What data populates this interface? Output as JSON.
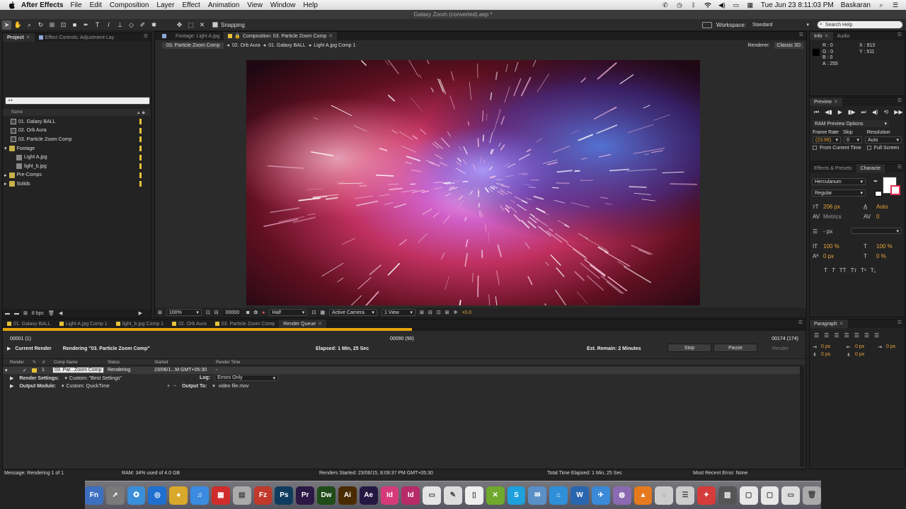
{
  "menubar": {
    "app_name": "After Effects",
    "items": [
      "File",
      "Edit",
      "Composition",
      "Layer",
      "Effect",
      "Animation",
      "View",
      "Window",
      "Help"
    ],
    "clock": "Tue Jun 23  8:11:03 PM",
    "user": "Baskaran"
  },
  "window_title": "Galaxy Zoom (converted).aep *",
  "toolbar": {
    "snapping_label": "Snapping",
    "workspace_label": "Workspace:",
    "workspace_value": "Standard",
    "search_placeholder": "Search Help"
  },
  "project_panel": {
    "tabs": [
      "Project",
      "Effect Controls: Adjustment Lay"
    ],
    "search_value": "",
    "column_name": "Name",
    "items": [
      {
        "name": "01. Galaxy BALL",
        "type": "comp",
        "indent": 0
      },
      {
        "name": "02. Orb Aura",
        "type": "comp",
        "indent": 0
      },
      {
        "name": "03. Particle Zoom Comp",
        "type": "comp",
        "indent": 0
      },
      {
        "name": "Footage",
        "type": "folder",
        "indent": 0
      },
      {
        "name": "Light A.jpg",
        "type": "img",
        "indent": 1
      },
      {
        "name": "light_b.jpg",
        "type": "img",
        "indent": 1
      },
      {
        "name": "Pre-Comps",
        "type": "folder",
        "indent": 0
      },
      {
        "name": "Solids",
        "type": "folder",
        "indent": 0
      }
    ],
    "bpc": "8 bpc"
  },
  "comp_panel": {
    "tabs": [
      "Footage: Light A.jpg",
      "Composition: 03. Particle Zoom Comp"
    ],
    "breadcrumbs": [
      "03. Particle Zoom Comp",
      "02. Orb Aura",
      "01. Galaxy BALL",
      "Light A.jpg Comp 1"
    ],
    "renderer_label": "Renderer:",
    "renderer_value": "Classic 3D",
    "zoom": "100%",
    "timecode": "00000",
    "resolution": "Half",
    "camera": "Active Camera",
    "views": "1 View",
    "exposure": "+0.0"
  },
  "info_panel": {
    "tabs": [
      "Info",
      "Audio"
    ],
    "r": "R : 0",
    "g": "G : 0",
    "b": "B : 0",
    "a": "A : 255",
    "x": "X : 913",
    "y": "Y : 511"
  },
  "preview_panel": {
    "tab": "Preview",
    "ram_options": "RAM Preview Options",
    "frame_rate_label": "Frame Rate",
    "skip_label": "Skip",
    "resolution_label": "Resolution",
    "frame_rate_value": "(23.98)",
    "skip_value": "0",
    "resolution_value": "Auto",
    "from_current": "From Current Time",
    "full_screen": "Full Screen"
  },
  "character_panel": {
    "tabs": [
      "Effects & Presets",
      "Characte"
    ],
    "font": "Herculanum",
    "style": "Regular",
    "size": "206 px",
    "leading": "Auto",
    "kerning": "Metrics",
    "tracking": "0",
    "stroke": "- px",
    "v_scale": "100 %",
    "h_scale": "100 %",
    "baseline": "0 px",
    "tsume": "0 %"
  },
  "paragraph_panel": {
    "tab": "Paragraph",
    "v1": "0 px",
    "v2": "0 px",
    "v3": "0 px",
    "v4": "0 px",
    "v5": "0 px"
  },
  "timeline_tabs": [
    "01. Galaxy BALL",
    "Light A.jpg Comp 1",
    "light_b.jpg Comp 1",
    "02. Orb Aura",
    "03. Particle Zoom Comp",
    "Render Queue"
  ],
  "render_queue": {
    "start_frame": "00001 (1)",
    "mid_frame": "00090 (90)",
    "end_frame": "00174 (174)",
    "progress": 0.51,
    "current_render_label": "Current Render",
    "rendering_text": "Rendering \"03. Particle Zoom Comp\"",
    "elapsed": "Elapsed: 1 Min, 25 Sec",
    "remain": "Est. Remain: 2 Minutes",
    "stop": "Stop",
    "pause": "Pause",
    "render": "Render",
    "columns": [
      "Render",
      "#",
      "Comp Name",
      "Status",
      "Started",
      "Render Time"
    ],
    "row": {
      "num": "1",
      "comp": "03. Par...Zoom Comp",
      "status": "Rendering",
      "started": "23/06/1...M GMT+05:30",
      "time": "-"
    },
    "render_settings_label": "Render Settings:",
    "render_settings_value": "Custom: \"Best Settings\"",
    "log_label": "Log:",
    "log_value": "Errors Only",
    "output_module_label": "Output Module:",
    "output_module_value": "Custom: QuickTime",
    "output_to_label": "Output To:",
    "output_to_value": "video file.mov"
  },
  "status_bar": {
    "message": "Message: Rendering 1 of 1",
    "ram": "RAM: 34% used of 4.0 GB",
    "started": "Renders Started: 23/06/15, 8:09:37 PM GMT+05:30",
    "total": "Total Time Elapsed: 1 Min, 25 Sec",
    "error": "Most Recent Error: None"
  },
  "dock": [
    {
      "label": "Fn",
      "color": "#3c6fbf",
      "name": "finder"
    },
    {
      "label": "➚",
      "color": "#7a7a7a",
      "name": "launchpad"
    },
    {
      "label": "✪",
      "color": "#3a8fd8",
      "name": "safari"
    },
    {
      "label": "◎",
      "color": "#1e6fd0",
      "name": "firefox"
    },
    {
      "label": "●",
      "color": "#d9a92b",
      "name": "chrome"
    },
    {
      "label": "♫",
      "color": "#3b8be0",
      "name": "itunes"
    },
    {
      "label": "▦",
      "color": "#d02c2c",
      "name": "photobooth"
    },
    {
      "label": "▤",
      "color": "#aaa",
      "name": "preview"
    },
    {
      "label": "Fz",
      "color": "#c0392b",
      "name": "filezilla"
    },
    {
      "label": "Ps",
      "color": "#0f3c5e",
      "name": "photoshop"
    },
    {
      "label": "Pr",
      "color": "#2b1845",
      "name": "premiere"
    },
    {
      "label": "Dw",
      "color": "#1f4c18",
      "name": "dreamweaver"
    },
    {
      "label": "Ai",
      "color": "#4a2a00",
      "name": "illustrator"
    },
    {
      "label": "Ae",
      "color": "#241843",
      "name": "aftereffects"
    },
    {
      "label": "Id",
      "color": "#d63a7a",
      "name": "indesign"
    },
    {
      "label": "Id",
      "color": "#b62b68",
      "name": "incopy"
    },
    {
      "label": "▭",
      "color": "#e5e5e5",
      "name": "folder"
    },
    {
      "label": "✎",
      "color": "#ddd",
      "name": "textedit"
    },
    {
      "label": "▯",
      "color": "#eee",
      "name": "pages"
    },
    {
      "label": "✕",
      "color": "#6fa82b",
      "name": "xcode"
    },
    {
      "label": "S",
      "color": "#1ea0dc",
      "name": "skype"
    },
    {
      "label": "✉",
      "color": "#5a90c8",
      "name": "mail"
    },
    {
      "label": "⌂",
      "color": "#2f8fd8",
      "name": "network"
    },
    {
      "label": "W",
      "color": "#2a66b0",
      "name": "word"
    },
    {
      "label": "✈",
      "color": "#3a8ad8",
      "name": "airdrop"
    },
    {
      "label": "◍",
      "color": "#8a6ab0",
      "name": "app1"
    },
    {
      "label": "▲",
      "color": "#e67a1e",
      "name": "vlc"
    },
    {
      "label": "◌",
      "color": "#ccc",
      "name": "app2"
    },
    {
      "label": "☰",
      "color": "#ccc",
      "name": "app3"
    },
    {
      "label": "✦",
      "color": "#d53b3b",
      "name": "app4"
    },
    {
      "label": "▥",
      "color": "#555",
      "name": "film"
    },
    {
      "label": "▢",
      "color": "#e8e8e8",
      "name": "doc1"
    },
    {
      "label": "▢",
      "color": "#e8e8e8",
      "name": "doc2"
    },
    {
      "label": "▭",
      "color": "#ddd",
      "name": "doc3"
    },
    {
      "label": "🗑",
      "color": "#aaa",
      "name": "trash"
    }
  ]
}
